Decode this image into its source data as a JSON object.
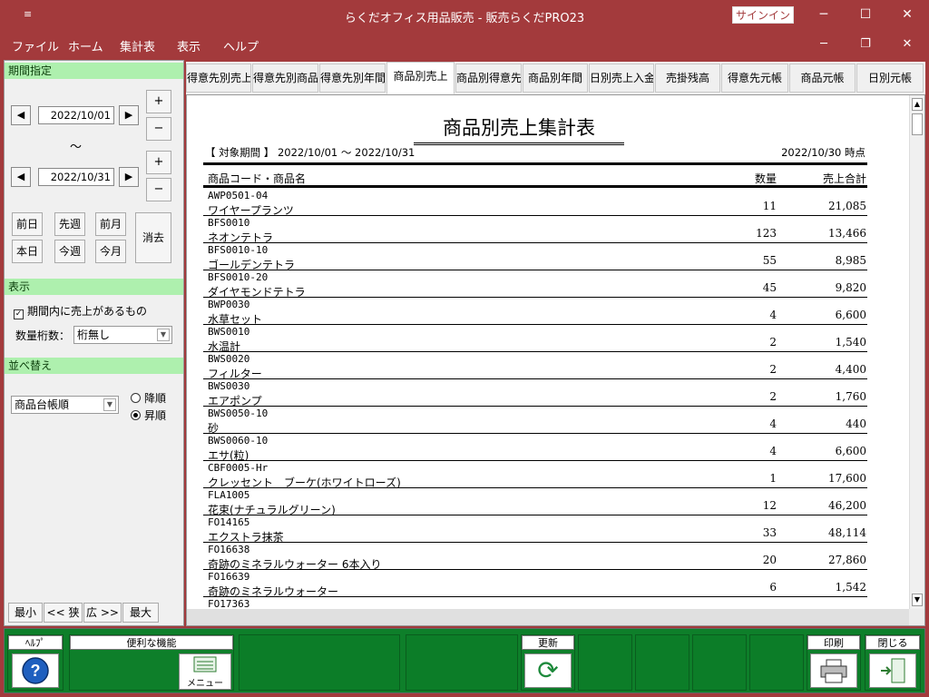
{
  "window": {
    "title": "らくだオフィス用品販売 - 販売らくだPRO23",
    "signin_label": "サインイン",
    "minimize_glyph": "─",
    "maximize_glyph": "☐",
    "close_glyph": "✕",
    "sysmenu_glyph": "≡"
  },
  "menu": {
    "items": [
      "ファイル",
      "ホーム",
      "集計表",
      "表示",
      "ヘルプ"
    ],
    "mdi_min": "─",
    "mdi_restore": "❐",
    "mdi_close": "✕"
  },
  "left": {
    "period_header": "期間指定",
    "date_from": "2022/10/01",
    "date_to": "2022/10/31",
    "tilde": "〜",
    "plus": "+",
    "minus": "−",
    "prev_glyph": "◀",
    "next_glyph": "▶",
    "quick": {
      "prev_day": "前日",
      "prev_week": "先週",
      "prev_month": "前月",
      "clear": "消去",
      "today": "本日",
      "this_week": "今週",
      "this_month": "今月"
    },
    "display_header": "表示",
    "only_with_sales_label": "期間内に売上があるもの",
    "only_with_sales_checked": true,
    "qty_digits_label": "数量桁数：",
    "qty_digits_value": "桁無し",
    "sort_header": "並べ替え",
    "sort_value": "商品台帳順",
    "desc_label": "降順",
    "asc_label": "昇順",
    "sort_order": "asc",
    "zoom": {
      "min": "最小",
      "narrow": "<< 狭",
      "wide": "広 >>",
      "max": "最大"
    }
  },
  "tabs": [
    {
      "label": "得意先別売上",
      "active": false
    },
    {
      "label": "得意先別商品",
      "active": false
    },
    {
      "label": "得意先別年間",
      "active": false
    },
    {
      "label": "商品別売上",
      "active": true
    },
    {
      "label": "商品別得意先",
      "active": false
    },
    {
      "label": "商品別年間",
      "active": false
    },
    {
      "label": "日別売上入金",
      "active": false
    },
    {
      "label": "売掛残高",
      "active": false
    },
    {
      "label": "得意先元帳",
      "active": false
    },
    {
      "label": "商品元帳",
      "active": false
    },
    {
      "label": "日別元帳",
      "active": false
    }
  ],
  "report": {
    "title": "商品別売上集計表",
    "period": "【 対象期間 】 2022/10/01 〜 2022/10/31",
    "timestamp": "2022/10/30 時点",
    "col_code_name": "商品コード・商品名",
    "col_qty": "数量",
    "col_total": "売上合計",
    "rows": [
      {
        "code": "AWP0501-04",
        "name": "ワイヤープランツ",
        "qty": "11",
        "amount": "21,085"
      },
      {
        "code": "BFS0010",
        "name": "ネオンテトラ",
        "qty": "123",
        "amount": "13,466"
      },
      {
        "code": "BFS0010-10",
        "name": "ゴールデンテトラ",
        "qty": "55",
        "amount": "8,985"
      },
      {
        "code": "BFS0010-20",
        "name": "ダイヤモンドテトラ",
        "qty": "45",
        "amount": "9,820"
      },
      {
        "code": "BWP0030",
        "name": "水草セット",
        "qty": "4",
        "amount": "6,600"
      },
      {
        "code": "BWS0010",
        "name": "水温計",
        "qty": "2",
        "amount": "1,540"
      },
      {
        "code": "BWS0020",
        "name": "フィルター",
        "qty": "2",
        "amount": "4,400"
      },
      {
        "code": "BWS0030",
        "name": "エアポンプ",
        "qty": "2",
        "amount": "1,760"
      },
      {
        "code": "BWS0050-10",
        "name": "砂",
        "qty": "4",
        "amount": "440"
      },
      {
        "code": "BWS0060-10",
        "name": "エサ(粒)",
        "qty": "4",
        "amount": "6,600"
      },
      {
        "code": "CBF0005-Hr",
        "name": "クレッセント　ブーケ(ホワイトローズ)",
        "qty": "1",
        "amount": "17,600"
      },
      {
        "code": "FLA1005",
        "name": "花束(ナチュラルグリーン)",
        "qty": "12",
        "amount": "46,200"
      },
      {
        "code": "FO14165",
        "name": "エクストラ抹茶",
        "qty": "33",
        "amount": "48,114"
      },
      {
        "code": "FO16638",
        "name": "奇跡のミネラルウォーター 6本入り",
        "qty": "20",
        "amount": "27,860"
      },
      {
        "code": "FO16639",
        "name": "奇跡のミネラルウォーター",
        "qty": "6",
        "amount": "1,542"
      },
      {
        "code": "FO17363",
        "name": "",
        "qty": "",
        "amount": ""
      }
    ]
  },
  "footer": {
    "help_label": "ﾍﾙﾌﾟ",
    "tools_label": "便利な機能",
    "menu_label": "メニュー",
    "refresh_label": "更新",
    "print_label": "印刷",
    "close_label": "閉じる",
    "help_glyph": "?",
    "refresh_glyph": "⟳"
  },
  "colors": {
    "title_bar": "#a33a3c",
    "section_header": "#aef0ae",
    "footer": "#0e7f2a",
    "help_icon": "#1f5fbf"
  }
}
